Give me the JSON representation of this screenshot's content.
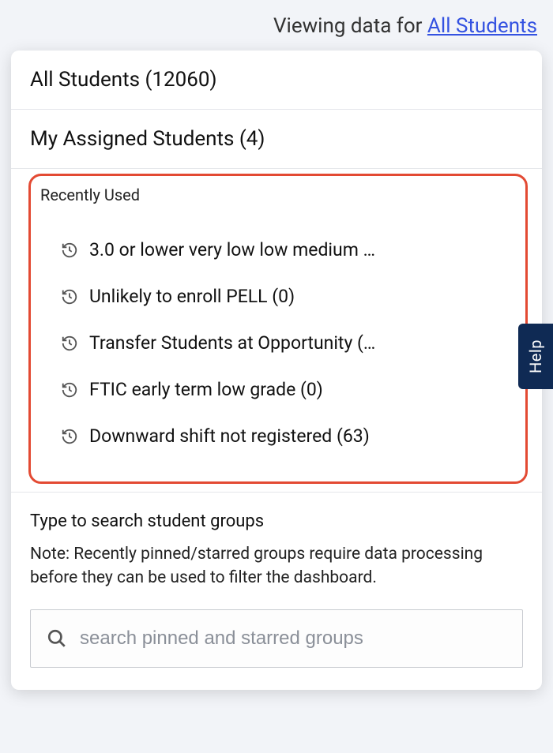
{
  "header": {
    "prefix": "Viewing data for ",
    "filter_link": "All Students"
  },
  "dropdown": {
    "all_students": "All Students (12060)",
    "my_assigned": "My Assigned Students (4)",
    "recent_heading": "Recently Used",
    "recent_items": [
      "3.0 or lower very low low medium …",
      "Unlikely to enroll PELL (0)",
      "Transfer Students at Opportunity (…",
      "FTIC early term low grade (0)",
      "Downward shift not registered (63)"
    ],
    "search_heading": "Type to search student groups",
    "search_note": "Note: Recently pinned/starred groups require data processing before they can be used to filter the dashboard.",
    "search_placeholder": "search pinned and starred groups"
  },
  "help_tab": "Help"
}
